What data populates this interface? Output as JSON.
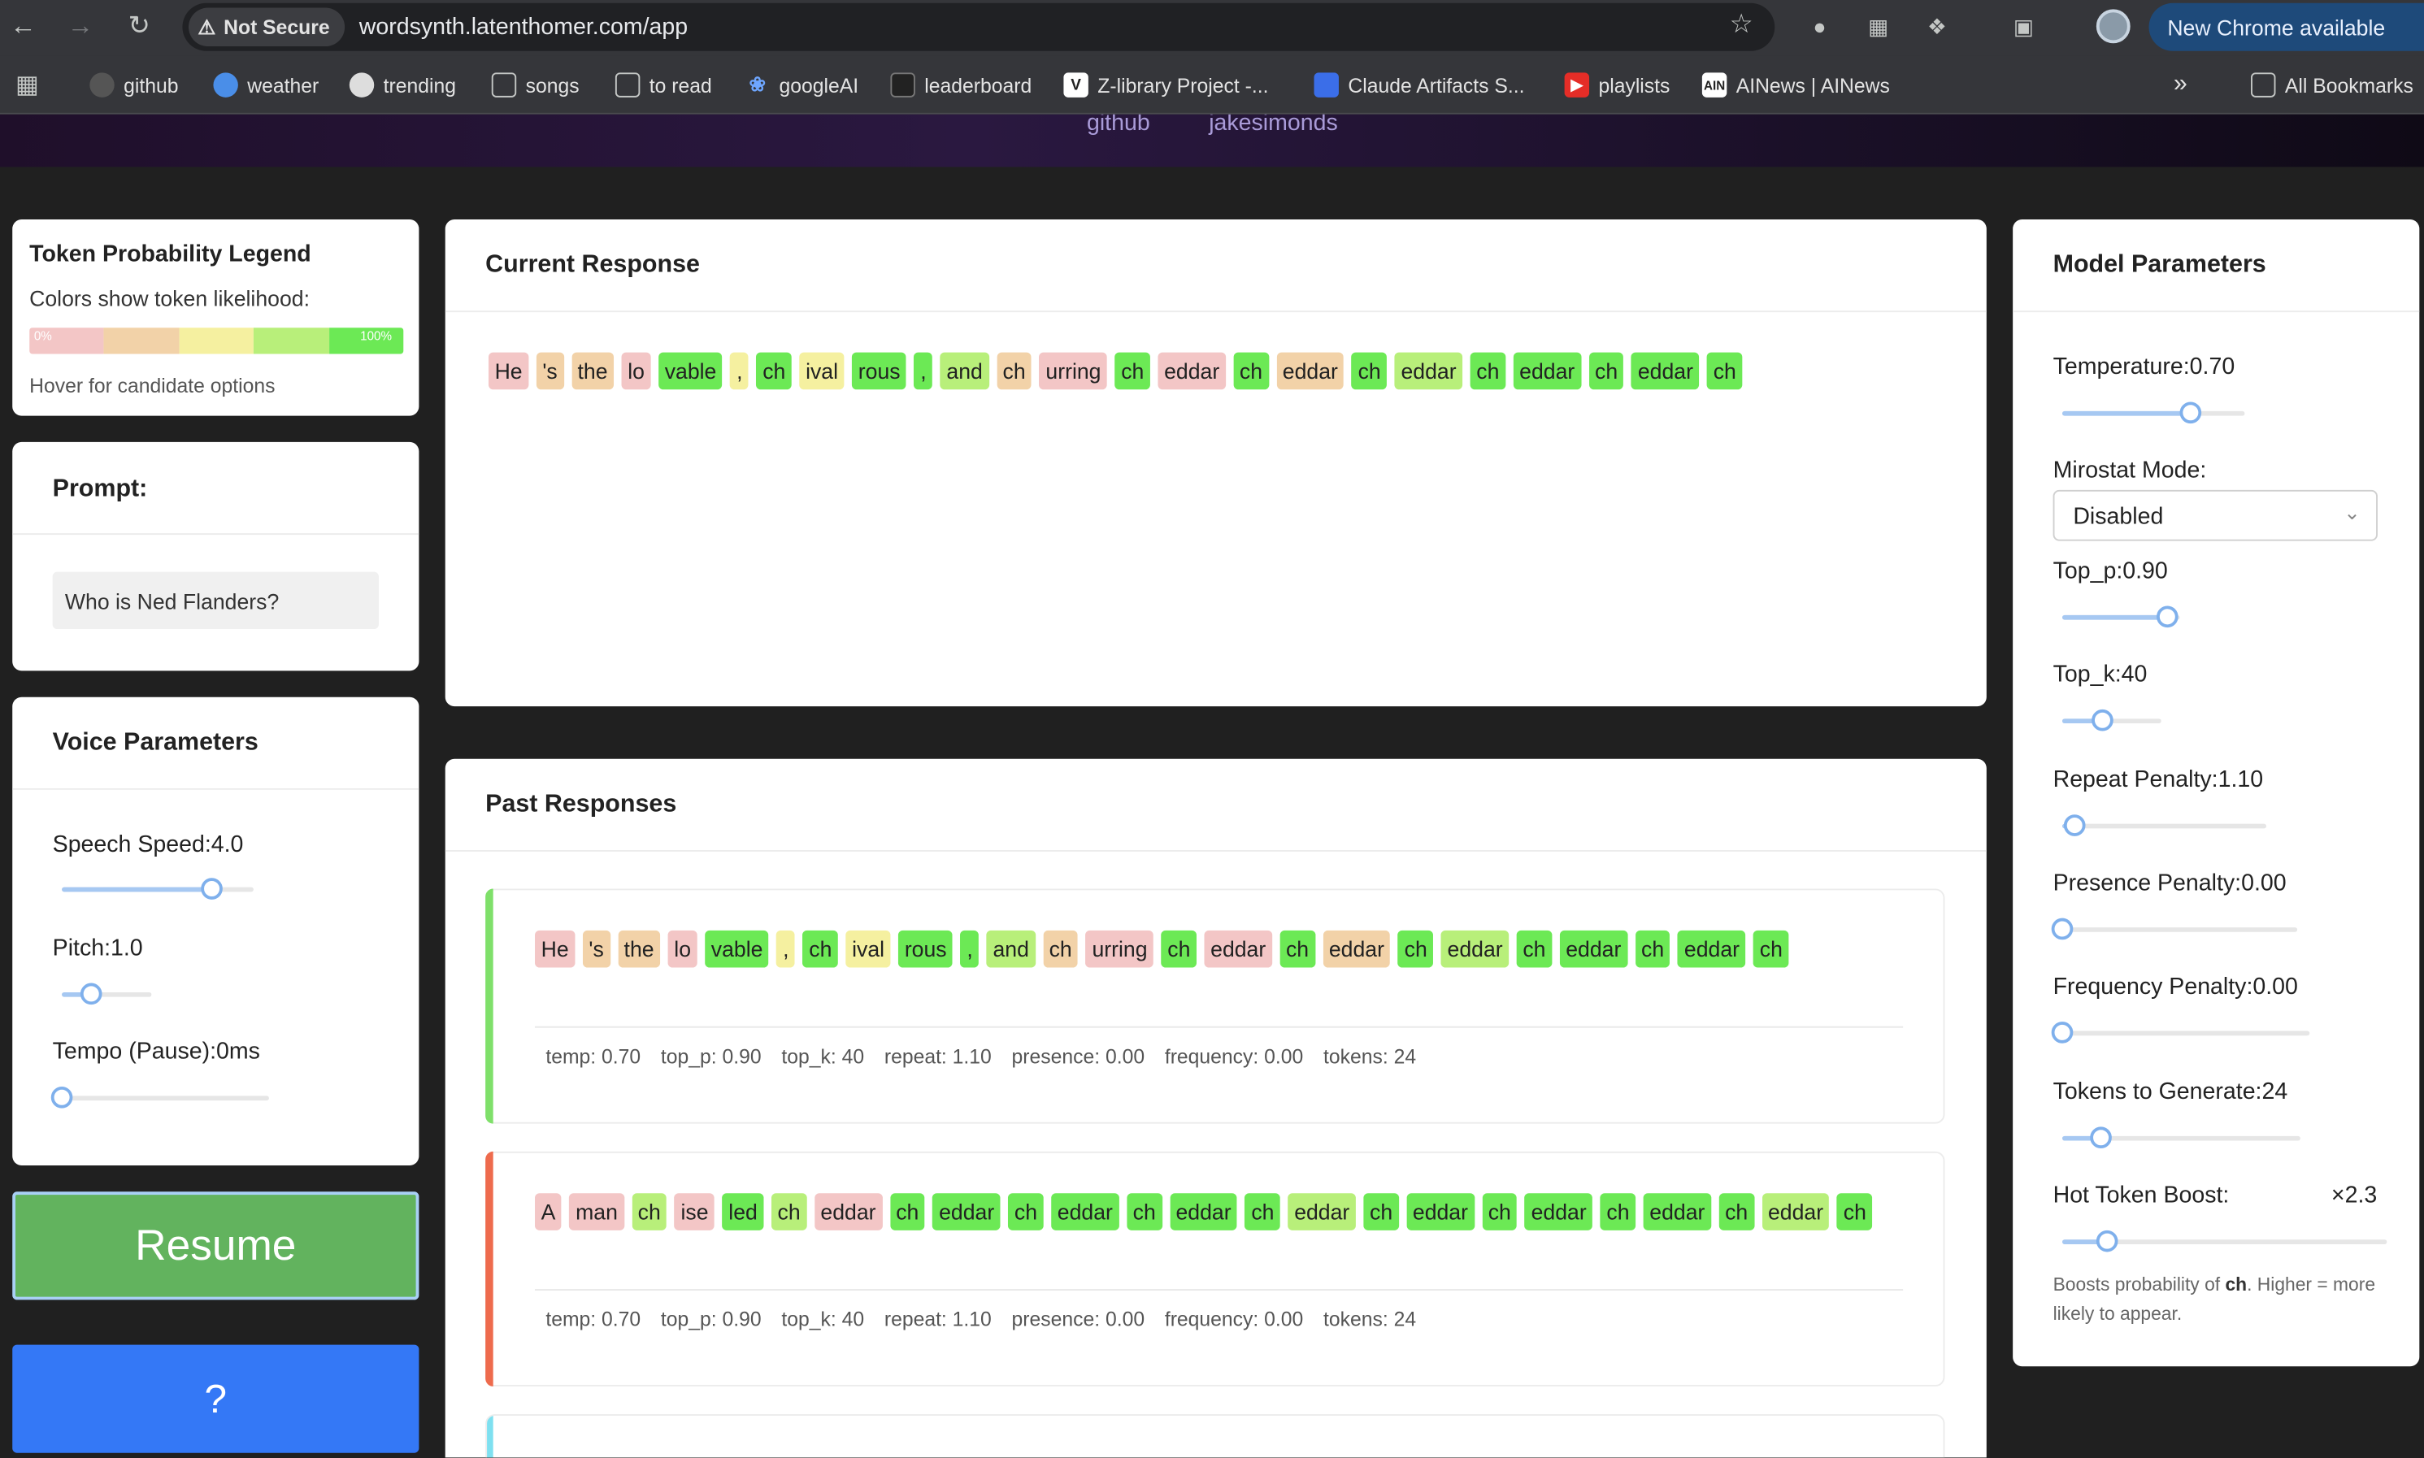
{
  "browser": {
    "security_label": "Not Secure",
    "url": "wordsynth.latenthomer.com/app",
    "new_chrome_label": "New Chrome available",
    "bookmarks": [
      "github",
      "weather",
      "trending",
      "songs",
      "to read",
      "googleAI",
      "leaderboard",
      "Z-library Project -...",
      "Claude Artifacts S...",
      "playlists",
      "AINews | AINews"
    ],
    "all_bookmarks_label": "All Bookmarks"
  },
  "header": {
    "links": [
      "github",
      "jakesimonds"
    ]
  },
  "legend": {
    "title": "Token Probability Legend",
    "subtitle": "Colors show token likelihood:",
    "min_label": "0%",
    "max_label": "100%",
    "hint": "Hover for candidate options",
    "colors": [
      "#f3c6c6",
      "#f2d2a8",
      "#f5f0a0",
      "#b8ef7a",
      "#6ce955"
    ]
  },
  "prompt": {
    "title": "Prompt:",
    "value": "Who is Ned Flanders?"
  },
  "voice": {
    "title": "Voice Parameters",
    "speed_label": "Speech Speed:4.0",
    "pitch_label": "Pitch:1.0",
    "tempo_label": "Tempo (Pause):0ms",
    "speed_fraction": 0.78,
    "pitch_fraction": 0.33,
    "tempo_fraction": 0.0
  },
  "buttons": {
    "resume": "Resume",
    "help": "?"
  },
  "current": {
    "title": "Current Response",
    "tokens": [
      [
        "He",
        "red"
      ],
      [
        "'s",
        "orange"
      ],
      [
        "the",
        "orange"
      ],
      [
        "lo",
        "red"
      ],
      [
        "vable",
        "green"
      ],
      [
        ",",
        "yellow"
      ],
      [
        "ch",
        "green"
      ],
      [
        "ival",
        "yellow"
      ],
      [
        "rous",
        "green"
      ],
      [
        ",",
        "green"
      ],
      [
        "and",
        "lime"
      ],
      [
        "ch",
        "orange"
      ],
      [
        "urring",
        "red"
      ],
      [
        "ch",
        "green"
      ],
      [
        "eddar",
        "red"
      ],
      [
        "ch",
        "green"
      ],
      [
        "eddar",
        "orange"
      ],
      [
        "ch",
        "green"
      ],
      [
        "eddar",
        "lime"
      ],
      [
        "ch",
        "green"
      ],
      [
        "eddar",
        "green"
      ],
      [
        "ch",
        "green"
      ],
      [
        "eddar",
        "green"
      ],
      [
        "ch",
        "green"
      ]
    ]
  },
  "past": {
    "title": "Past Responses",
    "responses": [
      {
        "bar_color": "#7fe06a",
        "tokens": [
          [
            "He",
            "red"
          ],
          [
            "'s",
            "orange"
          ],
          [
            "the",
            "orange"
          ],
          [
            "lo",
            "red"
          ],
          [
            "vable",
            "green"
          ],
          [
            ",",
            "yellow"
          ],
          [
            "ch",
            "green"
          ],
          [
            "ival",
            "yellow"
          ],
          [
            "rous",
            "green"
          ],
          [
            ",",
            "green"
          ],
          [
            "and",
            "lime"
          ],
          [
            "ch",
            "orange"
          ],
          [
            "urring",
            "red"
          ],
          [
            "ch",
            "green"
          ],
          [
            "eddar",
            "red"
          ],
          [
            "ch",
            "green"
          ],
          [
            "eddar",
            "orange"
          ],
          [
            "ch",
            "green"
          ],
          [
            "eddar",
            "lime"
          ],
          [
            "ch",
            "green"
          ],
          [
            "eddar",
            "green"
          ],
          [
            "ch",
            "green"
          ],
          [
            "eddar",
            "green"
          ],
          [
            "ch",
            "green"
          ]
        ],
        "meta": [
          "temp: 0.70",
          "top_p: 0.90",
          "top_k: 40",
          "repeat: 1.10",
          "presence: 0.00",
          "frequency: 0.00",
          "tokens: 24"
        ]
      },
      {
        "bar_color": "#ee6b4d",
        "tokens": [
          [
            "A",
            "red"
          ],
          [
            "man",
            "red"
          ],
          [
            "ch",
            "lime"
          ],
          [
            "ise",
            "red"
          ],
          [
            "led",
            "green"
          ],
          [
            "ch",
            "lime"
          ],
          [
            "eddar",
            "red"
          ],
          [
            "ch",
            "green"
          ],
          [
            "eddar",
            "green"
          ],
          [
            "ch",
            "green"
          ],
          [
            "eddar",
            "green"
          ],
          [
            "ch",
            "green"
          ],
          [
            "eddar",
            "green"
          ],
          [
            "ch",
            "green"
          ],
          [
            "eddar",
            "lime"
          ],
          [
            "ch",
            "green"
          ],
          [
            "eddar",
            "green"
          ],
          [
            "ch",
            "green"
          ],
          [
            "eddar",
            "green"
          ],
          [
            "ch",
            "green"
          ],
          [
            "eddar",
            "green"
          ],
          [
            "ch",
            "green"
          ],
          [
            "eddar",
            "lime"
          ],
          [
            "ch",
            "green"
          ]
        ],
        "meta": [
          "temp: 0.70",
          "top_p: 0.90",
          "top_k: 40",
          "repeat: 1.10",
          "presence: 0.00",
          "frequency: 0.00",
          "tokens: 24"
        ]
      }
    ]
  },
  "model": {
    "title": "Model Parameters",
    "temperature_label": "Temperature:0.70",
    "mirostat_label": "Mirostat Mode:",
    "mirostat_value": "Disabled",
    "top_p_label": "Top_p:0.90",
    "top_k_label": "Top_k:40",
    "repeat_label": "Repeat Penalty:1.10",
    "presence_label": "Presence Penalty:0.00",
    "frequency_label": "Frequency Penalty:0.00",
    "tokens_label": "Tokens to Generate:24",
    "hot_label": "Hot Token Boost:",
    "hot_value": "×2.3",
    "hot_note_pre": "Boosts probability of ",
    "hot_note_token": "ch",
    "hot_note_post": ". Higher = more likely to appear.",
    "temperature_fraction": 0.7,
    "top_p_fraction": 0.9,
    "top_k_fraction": 0.4,
    "repeat_fraction": 0.06,
    "presence_fraction": 0.0,
    "frequency_fraction": 0.0,
    "tokens_fraction": 0.16,
    "hot_fraction": 0.14
  }
}
